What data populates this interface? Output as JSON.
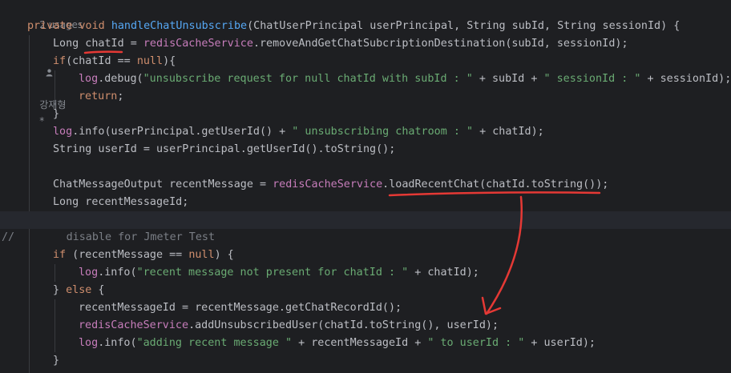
{
  "inlay_hints": {
    "usages": "2 usages",
    "author_icon": "person-icon",
    "author": "강재형",
    "author_suffix": "*"
  },
  "code": {
    "l1": {
      "a": "private",
      "b": "void",
      "c": "handleChatUnsubscribe",
      "d": "(ChatUserPrincipal userPrincipal, String subId, String sessionId) {"
    },
    "l2": {
      "a": "Long chatId = ",
      "b": "redisCacheService",
      "c": ".removeAndGetChatSubcriptionDestination(subId, sessionId);"
    },
    "l3": {
      "a": "if",
      "b": "(chatId == ",
      "c": "null",
      "d": "){"
    },
    "l4": {
      "a": "log",
      "b": ".debug(",
      "c": "\"unsubscribe request for null chatId with subId : \"",
      "d": " + subId + ",
      "e": "\" sessionId : \"",
      "f": " + sessionId);"
    },
    "l5": {
      "a": "return",
      "b": ";"
    },
    "l6": {
      "a": "}"
    },
    "l7": {
      "a": "log",
      "b": ".info(userPrincipal.getUserId() + ",
      "c": "\" unsubscribing chatroom : \"",
      "d": " + chatId);"
    },
    "l8": {
      "a": "String userId = userPrincipal.getUserId().toString();"
    },
    "l10": {
      "a": "ChatMessageOutput recentMessage = ",
      "b": "redisCacheService",
      "c": ".loadRecentChat(chatId.toString());"
    },
    "l11": {
      "a": "Long recentMessageId;"
    },
    "l13": {
      "a": "//        disable for Jmeter Test"
    },
    "l14": {
      "a": "if",
      "b": " (recentMessage == ",
      "c": "null",
      "d": ") {"
    },
    "l15": {
      "a": "log",
      "b": ".info(",
      "c": "\"recent message not present for chatId : \"",
      "d": " + chatId);"
    },
    "l16": {
      "a": "} ",
      "b": "else",
      "c": " {"
    },
    "l17": {
      "a": "recentMessageId = recentMessage.getChatRecordId();"
    },
    "l18": {
      "a": "redisCacheService",
      "b": ".addUnsubscribedUser(chatId.toString(), userId);"
    },
    "l19": {
      "a": "log",
      "b": ".info(",
      "c": "\"adding recent message \"",
      "d": " + recentMessageId + ",
      "e": "\" to userId : \"",
      "f": " + userId);"
    },
    "l20": {
      "a": "}"
    }
  },
  "colors": {
    "background": "#1e1f22",
    "keyword": "#cf8e6d",
    "method": "#56a8f5",
    "field": "#c77dbb",
    "string": "#6aab73",
    "comment": "#7a7e85",
    "text": "#bcbec4",
    "annotation": "#e53935"
  }
}
